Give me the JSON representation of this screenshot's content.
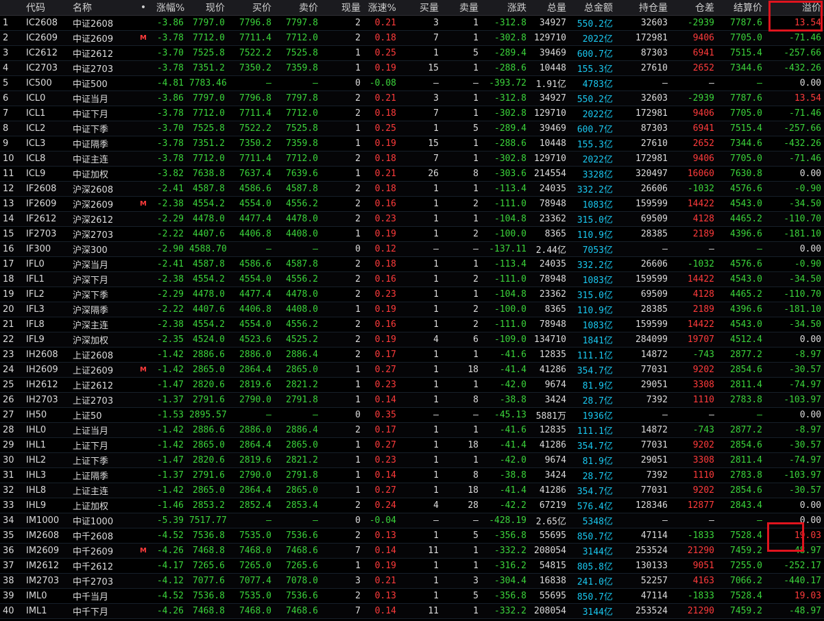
{
  "colors": {
    "up": "#ff3b3b",
    "down": "#3bd43b",
    "neutral": "#dcdcdc",
    "amount": "#19c8f0",
    "highlight": "#e0141e",
    "header_bg": "#1b1b1f"
  },
  "table": {
    "columns": [
      "",
      "代码",
      "名称",
      "•",
      "涨幅%",
      "现价",
      "买价",
      "卖价",
      "现量",
      "涨速%",
      "买量",
      "卖量",
      "涨跌",
      "总量",
      "总金额",
      "持仓量",
      "仓差",
      "结算价",
      "溢价"
    ],
    "rows": [
      [
        "1",
        "IC2608",
        "中证2608",
        "",
        "-3.86",
        "7797.0",
        "7796.8",
        "7797.8",
        "2",
        "0.21",
        "3",
        "1",
        "-312.8",
        "34927",
        "550.2亿",
        "32603",
        "-2939",
        "7787.6",
        "13.54"
      ],
      [
        "2",
        "IC2609",
        "中证2609",
        "M",
        "-3.78",
        "7712.0",
        "7711.4",
        "7712.0",
        "2",
        "0.18",
        "7",
        "1",
        "-302.8",
        "129710",
        "2022亿",
        "172981",
        "9406",
        "7705.0",
        "-71.46"
      ],
      [
        "3",
        "IC2612",
        "中证2612",
        "",
        "-3.70",
        "7525.8",
        "7522.2",
        "7525.8",
        "1",
        "0.25",
        "1",
        "5",
        "-289.4",
        "39469",
        "600.7亿",
        "87303",
        "6941",
        "7515.4",
        "-257.66"
      ],
      [
        "4",
        "IC2703",
        "中证2703",
        "",
        "-3.78",
        "7351.2",
        "7350.2",
        "7359.8",
        "1",
        "0.19",
        "15",
        "1",
        "-288.6",
        "10448",
        "155.3亿",
        "27610",
        "2652",
        "7344.6",
        "-432.26"
      ],
      [
        "5",
        "IC500",
        "中证500",
        "",
        "-4.81",
        "7783.46",
        "–",
        "–",
        "0",
        "-0.08",
        "–",
        "–",
        "-393.72",
        "1.91亿",
        "4783亿",
        "–",
        "–",
        "–",
        "0.00"
      ],
      [
        "6",
        "ICL0",
        "中证当月",
        "",
        "-3.86",
        "7797.0",
        "7796.8",
        "7797.8",
        "2",
        "0.21",
        "3",
        "1",
        "-312.8",
        "34927",
        "550.2亿",
        "32603",
        "-2939",
        "7787.6",
        "13.54"
      ],
      [
        "7",
        "ICL1",
        "中证下月",
        "",
        "-3.78",
        "7712.0",
        "7711.4",
        "7712.0",
        "2",
        "0.18",
        "7",
        "1",
        "-302.8",
        "129710",
        "2022亿",
        "172981",
        "9406",
        "7705.0",
        "-71.46"
      ],
      [
        "8",
        "ICL2",
        "中证下季",
        "",
        "-3.70",
        "7525.8",
        "7522.2",
        "7525.8",
        "1",
        "0.25",
        "1",
        "5",
        "-289.4",
        "39469",
        "600.7亿",
        "87303",
        "6941",
        "7515.4",
        "-257.66"
      ],
      [
        "9",
        "ICL3",
        "中证隔季",
        "",
        "-3.78",
        "7351.2",
        "7350.2",
        "7359.8",
        "1",
        "0.19",
        "15",
        "1",
        "-288.6",
        "10448",
        "155.3亿",
        "27610",
        "2652",
        "7344.6",
        "-432.26"
      ],
      [
        "10",
        "ICL8",
        "中证主连",
        "",
        "-3.78",
        "7712.0",
        "7711.4",
        "7712.0",
        "2",
        "0.18",
        "7",
        "1",
        "-302.8",
        "129710",
        "2022亿",
        "172981",
        "9406",
        "7705.0",
        "-71.46"
      ],
      [
        "11",
        "ICL9",
        "中证加权",
        "",
        "-3.82",
        "7638.8",
        "7637.4",
        "7639.6",
        "1",
        "0.21",
        "26",
        "8",
        "-303.6",
        "214554",
        "3328亿",
        "320497",
        "16060",
        "7630.8",
        "0.00"
      ],
      [
        "12",
        "IF2608",
        "沪深2608",
        "",
        "-2.41",
        "4587.8",
        "4586.6",
        "4587.8",
        "2",
        "0.18",
        "1",
        "1",
        "-113.4",
        "24035",
        "332.2亿",
        "26606",
        "-1032",
        "4576.6",
        "-0.90"
      ],
      [
        "13",
        "IF2609",
        "沪深2609",
        "M",
        "-2.38",
        "4554.2",
        "4554.0",
        "4556.2",
        "2",
        "0.16",
        "1",
        "2",
        "-111.0",
        "78948",
        "1083亿",
        "159599",
        "14422",
        "4543.0",
        "-34.50"
      ],
      [
        "14",
        "IF2612",
        "沪深2612",
        "",
        "-2.29",
        "4478.0",
        "4477.4",
        "4478.0",
        "2",
        "0.23",
        "1",
        "1",
        "-104.8",
        "23362",
        "315.0亿",
        "69509",
        "4128",
        "4465.2",
        "-110.70"
      ],
      [
        "15",
        "IF2703",
        "沪深2703",
        "",
        "-2.22",
        "4407.6",
        "4406.8",
        "4408.0",
        "1",
        "0.19",
        "1",
        "2",
        "-100.0",
        "8365",
        "110.9亿",
        "28385",
        "2189",
        "4396.6",
        "-181.10"
      ],
      [
        "16",
        "IF300",
        "沪深300",
        "",
        "-2.90",
        "4588.70",
        "–",
        "–",
        "0",
        "0.12",
        "–",
        "–",
        "-137.11",
        "2.44亿",
        "7053亿",
        "–",
        "–",
        "–",
        "0.00"
      ],
      [
        "17",
        "IFL0",
        "沪深当月",
        "",
        "-2.41",
        "4587.8",
        "4586.6",
        "4587.8",
        "2",
        "0.18",
        "1",
        "1",
        "-113.4",
        "24035",
        "332.2亿",
        "26606",
        "-1032",
        "4576.6",
        "-0.90"
      ],
      [
        "18",
        "IFL1",
        "沪深下月",
        "",
        "-2.38",
        "4554.2",
        "4554.0",
        "4556.2",
        "2",
        "0.16",
        "1",
        "2",
        "-111.0",
        "78948",
        "1083亿",
        "159599",
        "14422",
        "4543.0",
        "-34.50"
      ],
      [
        "19",
        "IFL2",
        "沪深下季",
        "",
        "-2.29",
        "4478.0",
        "4477.4",
        "4478.0",
        "2",
        "0.23",
        "1",
        "1",
        "-104.8",
        "23362",
        "315.0亿",
        "69509",
        "4128",
        "4465.2",
        "-110.70"
      ],
      [
        "20",
        "IFL3",
        "沪深隔季",
        "",
        "-2.22",
        "4407.6",
        "4406.8",
        "4408.0",
        "1",
        "0.19",
        "1",
        "2",
        "-100.0",
        "8365",
        "110.9亿",
        "28385",
        "2189",
        "4396.6",
        "-181.10"
      ],
      [
        "21",
        "IFL8",
        "沪深主连",
        "",
        "-2.38",
        "4554.2",
        "4554.0",
        "4556.2",
        "2",
        "0.16",
        "1",
        "2",
        "-111.0",
        "78948",
        "1083亿",
        "159599",
        "14422",
        "4543.0",
        "-34.50"
      ],
      [
        "22",
        "IFL9",
        "沪深加权",
        "",
        "-2.35",
        "4524.0",
        "4523.6",
        "4525.2",
        "2",
        "0.19",
        "4",
        "6",
        "-109.0",
        "134710",
        "1841亿",
        "284099",
        "19707",
        "4512.4",
        "0.00"
      ],
      [
        "23",
        "IH2608",
        "上证2608",
        "",
        "-1.42",
        "2886.6",
        "2886.0",
        "2886.4",
        "2",
        "0.17",
        "1",
        "1",
        "-41.6",
        "12835",
        "111.1亿",
        "14872",
        "-743",
        "2877.2",
        "-8.97"
      ],
      [
        "24",
        "IH2609",
        "上证2609",
        "M",
        "-1.42",
        "2865.0",
        "2864.4",
        "2865.0",
        "1",
        "0.27",
        "1",
        "18",
        "-41.4",
        "41286",
        "354.7亿",
        "77031",
        "9202",
        "2854.6",
        "-30.57"
      ],
      [
        "25",
        "IH2612",
        "上证2612",
        "",
        "-1.47",
        "2820.6",
        "2819.6",
        "2821.2",
        "1",
        "0.23",
        "1",
        "1",
        "-42.0",
        "9674",
        "81.9亿",
        "29051",
        "3308",
        "2811.4",
        "-74.97"
      ],
      [
        "26",
        "IH2703",
        "上证2703",
        "",
        "-1.37",
        "2791.6",
        "2790.0",
        "2791.8",
        "1",
        "0.14",
        "1",
        "8",
        "-38.8",
        "3424",
        "28.7亿",
        "7392",
        "1110",
        "2783.8",
        "-103.97"
      ],
      [
        "27",
        "IH50",
        "上证50",
        "",
        "-1.53",
        "2895.57",
        "–",
        "–",
        "0",
        "0.35",
        "–",
        "–",
        "-45.13",
        "5881万",
        "1936亿",
        "–",
        "–",
        "–",
        "0.00"
      ],
      [
        "28",
        "IHL0",
        "上证当月",
        "",
        "-1.42",
        "2886.6",
        "2886.0",
        "2886.4",
        "2",
        "0.17",
        "1",
        "1",
        "-41.6",
        "12835",
        "111.1亿",
        "14872",
        "-743",
        "2877.2",
        "-8.97"
      ],
      [
        "29",
        "IHL1",
        "上证下月",
        "",
        "-1.42",
        "2865.0",
        "2864.4",
        "2865.0",
        "1",
        "0.27",
        "1",
        "18",
        "-41.4",
        "41286",
        "354.7亿",
        "77031",
        "9202",
        "2854.6",
        "-30.57"
      ],
      [
        "30",
        "IHL2",
        "上证下季",
        "",
        "-1.47",
        "2820.6",
        "2819.6",
        "2821.2",
        "1",
        "0.23",
        "1",
        "1",
        "-42.0",
        "9674",
        "81.9亿",
        "29051",
        "3308",
        "2811.4",
        "-74.97"
      ],
      [
        "31",
        "IHL3",
        "上证隔季",
        "",
        "-1.37",
        "2791.6",
        "2790.0",
        "2791.8",
        "1",
        "0.14",
        "1",
        "8",
        "-38.8",
        "3424",
        "28.7亿",
        "7392",
        "1110",
        "2783.8",
        "-103.97"
      ],
      [
        "32",
        "IHL8",
        "上证主连",
        "",
        "-1.42",
        "2865.0",
        "2864.4",
        "2865.0",
        "1",
        "0.27",
        "1",
        "18",
        "-41.4",
        "41286",
        "354.7亿",
        "77031",
        "9202",
        "2854.6",
        "-30.57"
      ],
      [
        "33",
        "IHL9",
        "上证加权",
        "",
        "-1.46",
        "2853.2",
        "2852.4",
        "2853.4",
        "2",
        "0.24",
        "4",
        "28",
        "-42.2",
        "67219",
        "576.4亿",
        "128346",
        "12877",
        "2843.4",
        "0.00"
      ],
      [
        "34",
        "IM1000",
        "中证1000",
        "",
        "-5.39",
        "7517.77",
        "–",
        "–",
        "0",
        "-0.04",
        "–",
        "–",
        "-428.19",
        "2.65亿",
        "5348亿",
        "–",
        "–",
        "–",
        "0.00"
      ],
      [
        "35",
        "IM2608",
        "中千2608",
        "",
        "-4.52",
        "7536.8",
        "7535.0",
        "7536.6",
        "2",
        "0.13",
        "1",
        "5",
        "-356.8",
        "55695",
        "850.7亿",
        "47114",
        "-1833",
        "7528.4",
        "19.03"
      ],
      [
        "36",
        "IM2609",
        "中千2609",
        "M",
        "-4.26",
        "7468.8",
        "7468.0",
        "7468.6",
        "7",
        "0.14",
        "11",
        "1",
        "-332.2",
        "208054",
        "3144亿",
        "253524",
        "21290",
        "7459.2",
        "-48.97"
      ],
      [
        "37",
        "IM2612",
        "中千2612",
        "",
        "-4.17",
        "7265.6",
        "7265.0",
        "7265.6",
        "1",
        "0.19",
        "1",
        "1",
        "-316.2",
        "54815",
        "805.8亿",
        "130133",
        "9051",
        "7255.0",
        "-252.17"
      ],
      [
        "38",
        "IM2703",
        "中千2703",
        "",
        "-4.12",
        "7077.6",
        "7077.4",
        "7078.0",
        "3",
        "0.21",
        "1",
        "3",
        "-304.4",
        "16838",
        "241.0亿",
        "52257",
        "4163",
        "7066.2",
        "-440.17"
      ],
      [
        "39",
        "IML0",
        "中千当月",
        "",
        "-4.52",
        "7536.8",
        "7535.0",
        "7536.6",
        "2",
        "0.13",
        "1",
        "5",
        "-356.8",
        "55695",
        "850.7亿",
        "47114",
        "-1833",
        "7528.4",
        "19.03"
      ],
      [
        "40",
        "IML1",
        "中千下月",
        "",
        "-4.26",
        "7468.8",
        "7468.0",
        "7468.6",
        "7",
        "0.14",
        "11",
        "1",
        "-332.2",
        "208054",
        "3144亿",
        "253524",
        "21290",
        "7459.2",
        "-48.97"
      ]
    ]
  }
}
